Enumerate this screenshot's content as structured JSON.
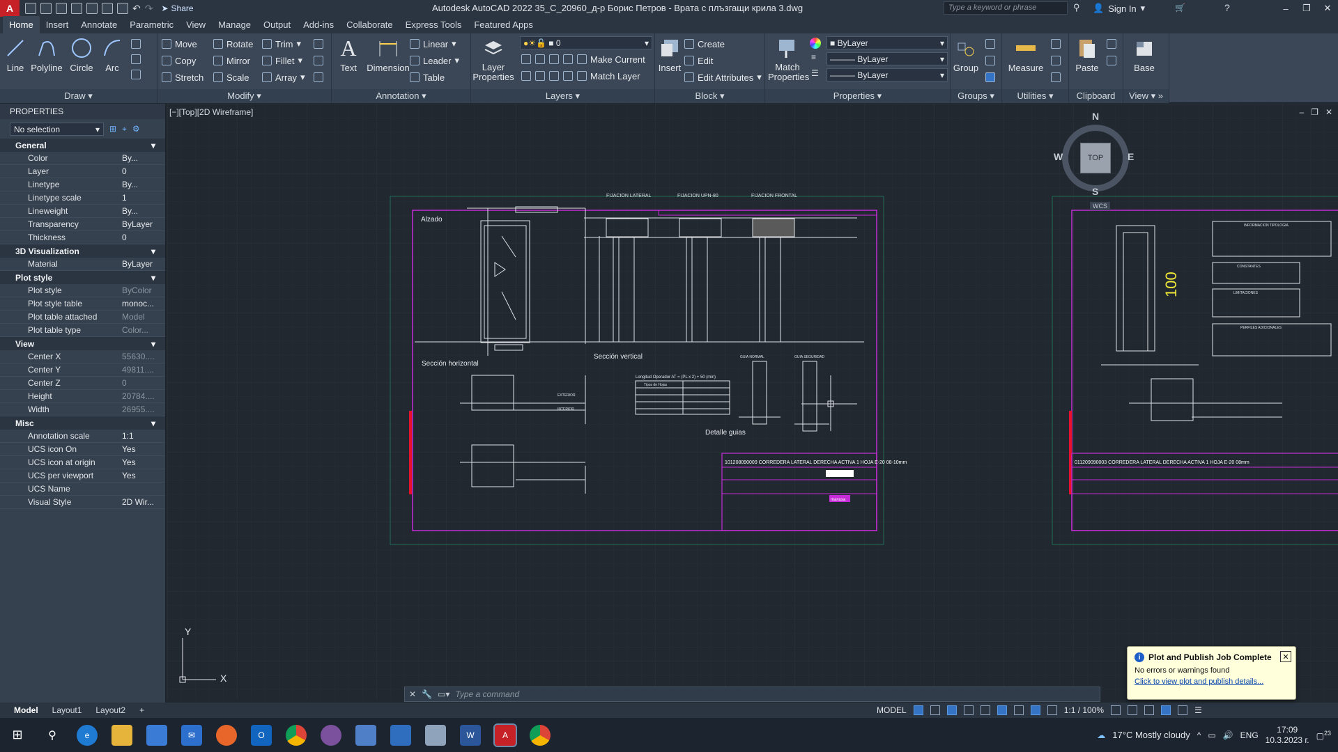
{
  "app": {
    "title": "Autodesk AutoCAD 2022   35_C_20960_д-р Борис Петров - Врата с плъзгащи крила 3.dwg",
    "logo": "A",
    "share": "Share",
    "search_placeholder": "Type a keyword or phrase",
    "sign_in": "Sign In"
  },
  "tabs": [
    "Home",
    "Insert",
    "Annotate",
    "Parametric",
    "View",
    "Manage",
    "Output",
    "Add-ins",
    "Collaborate",
    "Express Tools",
    "Featured Apps"
  ],
  "ribbon": {
    "draw": {
      "title": "Draw",
      "line": "Line",
      "polyline": "Polyline",
      "circle": "Circle",
      "arc": "Arc"
    },
    "modify": {
      "title": "Modify",
      "move": "Move",
      "rotate": "Rotate",
      "trim": "Trim",
      "copy": "Copy",
      "mirror": "Mirror",
      "fillet": "Fillet",
      "stretch": "Stretch",
      "scale": "Scale",
      "array": "Array"
    },
    "annotation": {
      "title": "Annotation",
      "text": "Text",
      "dimension": "Dimension",
      "linear": "Linear",
      "leader": "Leader",
      "table": "Table"
    },
    "layers": {
      "title": "Layers",
      "layer_properties": "Layer Properties",
      "current_layer": "0",
      "make_current": "Make Current",
      "match_layer": "Match Layer"
    },
    "block": {
      "title": "Block",
      "insert": "Insert",
      "create": "Create",
      "edit": "Edit",
      "edit_attributes": "Edit Attributes"
    },
    "properties": {
      "title": "Properties",
      "match_properties": "Match Properties",
      "color": "ByLayer",
      "linetype": "ByLayer",
      "lineweight": "ByLayer"
    },
    "groups": {
      "title": "Groups",
      "group": "Group"
    },
    "utilities": {
      "title": "Utilities",
      "measure": "Measure"
    },
    "clipboard": {
      "title": "Clipboard",
      "paste": "Paste"
    },
    "view": {
      "title": "View",
      "base": "Base"
    }
  },
  "properties_palette": {
    "header": "PROPERTIES",
    "selection": "No selection",
    "sections": [
      {
        "name": "General",
        "rows": [
          {
            "label": "Color",
            "value": "By..."
          },
          {
            "label": "Layer",
            "value": "0"
          },
          {
            "label": "Linetype",
            "value": "By..."
          },
          {
            "label": "Linetype scale",
            "value": "1"
          },
          {
            "label": "Lineweight",
            "value": "By..."
          },
          {
            "label": "Transparency",
            "value": "ByLayer"
          },
          {
            "label": "Thickness",
            "value": "0"
          }
        ]
      },
      {
        "name": "3D Visualization",
        "rows": [
          {
            "label": "Material",
            "value": "ByLayer"
          }
        ]
      },
      {
        "name": "Plot style",
        "rows": [
          {
            "label": "Plot style",
            "value": "ByColor"
          },
          {
            "label": "Plot style table",
            "value": "monoc..."
          },
          {
            "label": "Plot table attached to",
            "value": "Model"
          },
          {
            "label": "Plot table type",
            "value": "Color..."
          }
        ]
      },
      {
        "name": "View",
        "rows": [
          {
            "label": "Center X",
            "value": "55630...."
          },
          {
            "label": "Center Y",
            "value": "49811...."
          },
          {
            "label": "Center Z",
            "value": "0"
          },
          {
            "label": "Height",
            "value": "20784...."
          },
          {
            "label": "Width",
            "value": "26955...."
          }
        ]
      },
      {
        "name": "Misc",
        "rows": [
          {
            "label": "Annotation scale",
            "value": "1:1"
          },
          {
            "label": "UCS icon On",
            "value": "Yes"
          },
          {
            "label": "UCS icon at origin",
            "value": "Yes"
          },
          {
            "label": "UCS per viewport",
            "value": "Yes"
          },
          {
            "label": "UCS Name",
            "value": ""
          },
          {
            "label": "Visual Style",
            "value": "2D Wir..."
          }
        ]
      }
    ]
  },
  "viewport": {
    "label": "[−][Top][2D Wireframe]",
    "viewcube": {
      "n": "N",
      "s": "S",
      "e": "E",
      "w": "W",
      "face": "TOP",
      "wcs": "WCS"
    },
    "ucs": {
      "x": "X",
      "y": "Y"
    }
  },
  "drawing": {
    "alzado": "Alzado",
    "seccion_horizontal": "Sección horizontal",
    "seccion_vertical": "Sección vertical",
    "detalle_guias": "Detalle guias",
    "fijacion_lateral": "FIJACION LATERAL",
    "fijacion_upn": "FIJACION UPN-80",
    "fijacion_frontal": "FIJACION FRONTAL",
    "guia_normal": "GUIA NORMAL",
    "guia_seguridad": "GUIA SEGURIDAD",
    "exterior": "EXTERIOR",
    "interior": "INTERIOR",
    "longitud_operador": "Longitud Operador AT = (PL x 2) + 50 (min)",
    "tipo_hojas": "Tipos de Hojas",
    "title_main": "101208090009 CORREDERA LATERAL DERECHA ACTIVA 1 HOJA E-20 08-10mm",
    "title_second": "011209090003 CORREDERA LATERAL DERECHA ACTIVA 1 HOJA E-20 08mm",
    "info_tipologia": "INFORMACION TIPOLOGIA",
    "constantes": "CONSTANTES",
    "limitaciones": "LIMITACIONES",
    "perfiles": "PERFILES ADICIONALES",
    "dim_100": "100",
    "brand": "manusa"
  },
  "command_line": {
    "placeholder": "Type a command"
  },
  "layout_tabs": [
    "Model",
    "Layout1",
    "Layout2",
    "+"
  ],
  "status": {
    "model": "MODEL",
    "scale": "1:1 / 100%"
  },
  "notification": {
    "title": "Plot and Publish Job Complete",
    "message": "No errors or warnings found",
    "link": "Click to view plot and publish details..."
  },
  "taskbar": {
    "weather": "17°C  Mostly cloudy",
    "lang": "ENG",
    "time": "17:09",
    "date": "10.3.2023 г.",
    "notif_count": "23"
  },
  "colors": {
    "accent": "#3574c4",
    "autocad_red": "#c52127",
    "magenta": "#c62bd8",
    "cad_bg": "#212830"
  }
}
